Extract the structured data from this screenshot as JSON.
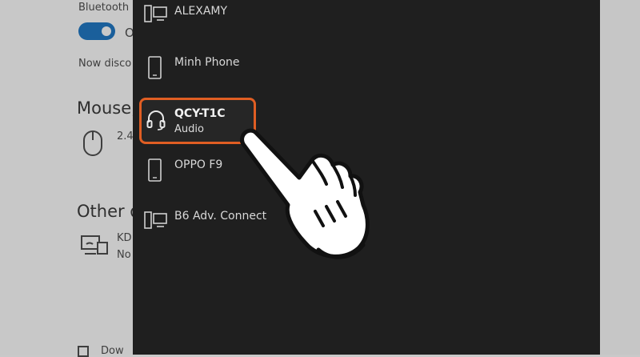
{
  "background": {
    "bluetooth_label": "Bluetooth",
    "toggle_text": "O",
    "now_discoverable": "Now disco",
    "mouse_heading": "Mouse,",
    "mouse_detail": "2.4",
    "other_heading": "Other d",
    "kd_label": "KD",
    "kd_sub": "No",
    "bottom_label": "Dow"
  },
  "devices": [
    {
      "name": "ALEXAMY",
      "icon": "computer-icon"
    },
    {
      "name": "Minh Phone",
      "icon": "phone-icon"
    },
    {
      "name": "QCY-T1C",
      "sub": "Audio",
      "icon": "headphones-icon",
      "selected": true
    },
    {
      "name": "OPPO F9",
      "icon": "phone-icon"
    },
    {
      "name": "B6 Adv. Connect",
      "icon": "computer-icon"
    }
  ],
  "colors": {
    "panel": "#1f1f1f",
    "highlight": "#e05e23",
    "toggle": "#1a5f9b"
  }
}
